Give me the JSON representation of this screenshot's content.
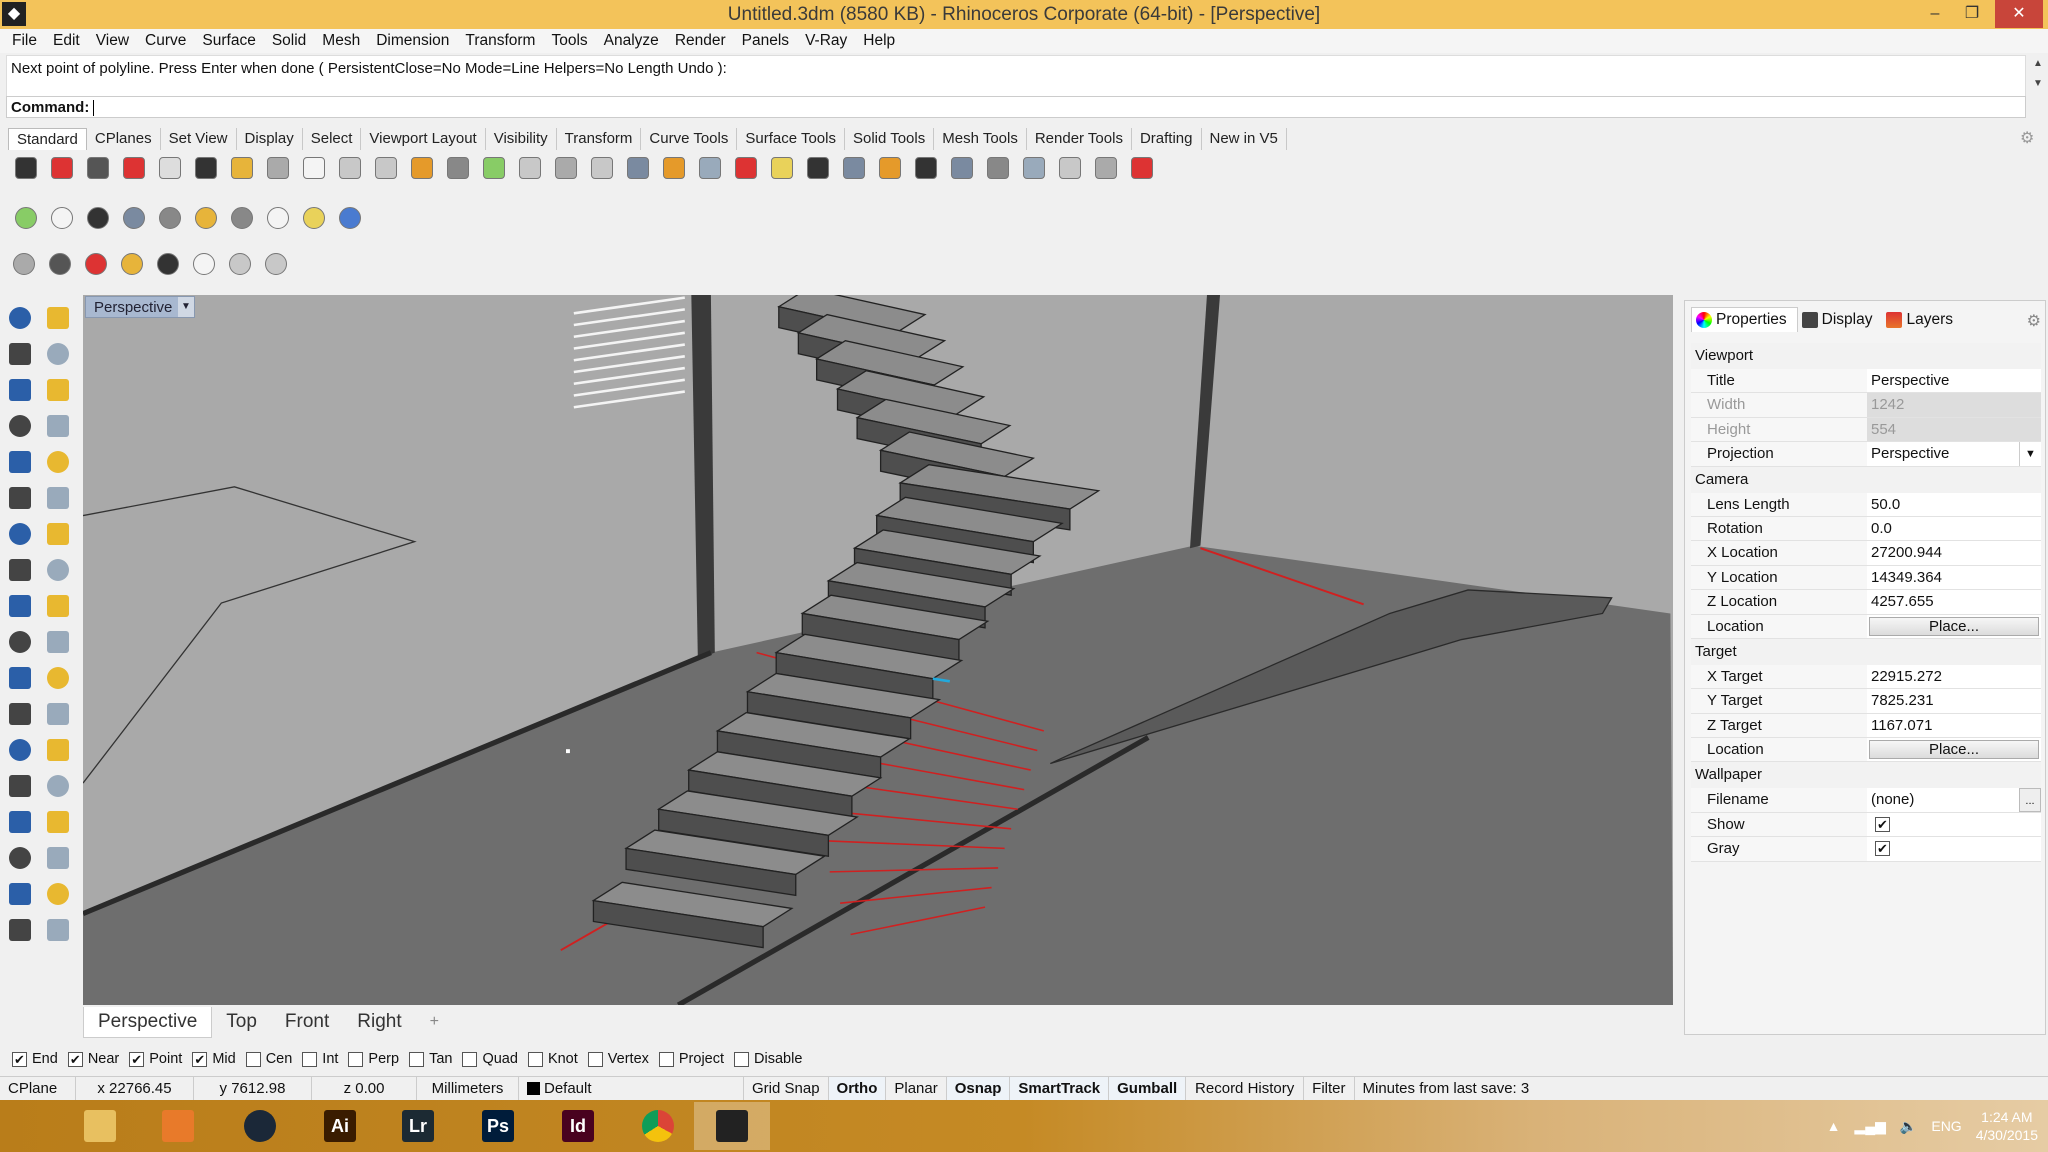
{
  "window": {
    "title": "Untitled.3dm (8580 KB) - Rhinoceros Corporate (64-bit) - [Perspective]",
    "minimize": "–",
    "restore": "❐",
    "close": "✕"
  },
  "menu": [
    "File",
    "Edit",
    "View",
    "Curve",
    "Surface",
    "Solid",
    "Mesh",
    "Dimension",
    "Transform",
    "Tools",
    "Analyze",
    "Render",
    "Panels",
    "V-Ray",
    "Help"
  ],
  "command": {
    "history": "Next point of polyline. Press Enter when done ( PersistentClose=No  Mode=Line  Helpers=No  Length  Undo ):",
    "prompt": "Command:",
    "value": ""
  },
  "toolbar_tabs": [
    "Standard",
    "CPlanes",
    "Set View",
    "Display",
    "Select",
    "Viewport Layout",
    "Visibility",
    "Transform",
    "Curve Tools",
    "Surface Tools",
    "Solid Tools",
    "Mesh Tools",
    "Render Tools",
    "Drafting",
    "New in V5"
  ],
  "toolbar_row1": [
    "new-file",
    "open",
    "save",
    "print",
    "import",
    "cut",
    "copy",
    "paste",
    "undo",
    "pan",
    "rotate-view",
    "zoom-dynamic",
    "zoom-window",
    "zoom-extents",
    "zoom-selected",
    "undo-view",
    "four-viewports",
    "car",
    "set-view",
    "osnap-circle",
    "points",
    "light-bulb",
    "lock",
    "layers",
    "color-wheel",
    "sphere-shaded",
    "sphere-rendered",
    "sphere-blue",
    "vray-lamp",
    "vray-settings",
    "dimension",
    "help"
  ],
  "toolbar_row2": [
    "vray-material",
    "vray-tag",
    "vray-tags",
    "vray-render",
    "vray-rt",
    "vray-lights",
    "vray-sun",
    "vray-sphere",
    "vray-forest",
    "vray-help"
  ],
  "toolbar_row3": [
    "sun-light",
    "plane-light",
    "sphere-light",
    "dome-light",
    "mesh-light",
    "spot-light",
    "ies-light",
    "directional-light"
  ],
  "left_tools": [
    "select",
    "point",
    "polyline",
    "curve",
    "circle",
    "arc",
    "polygon",
    "rectangle",
    "ellipse",
    "fillet",
    "surface",
    "revolve",
    "solid-box",
    "boolean",
    "extrude",
    "mesh",
    "transform-a",
    "transform-b",
    "move",
    "scale",
    "boolean-union",
    "boolean-split",
    "offset",
    "blend",
    "text",
    "dimension",
    "array",
    "group",
    "analyze-a",
    "analyze-b",
    "grid",
    "align",
    "render-a",
    "check",
    "render-b",
    "light"
  ],
  "colors": {
    "viewport_bg": "#a9a9a9",
    "floor": "#6e6e6e",
    "red_line": "#d02020",
    "accent": "#f3c35a"
  },
  "viewport": {
    "label": "Perspective"
  },
  "view_tabs": [
    "Perspective",
    "Top",
    "Front",
    "Right",
    "+"
  ],
  "osnap": [
    {
      "label": "End",
      "checked": true
    },
    {
      "label": "Near",
      "checked": true
    },
    {
      "label": "Point",
      "checked": true
    },
    {
      "label": "Mid",
      "checked": true
    },
    {
      "label": "Cen",
      "checked": false
    },
    {
      "label": "Int",
      "checked": false
    },
    {
      "label": "Perp",
      "checked": false
    },
    {
      "label": "Tan",
      "checked": false
    },
    {
      "label": "Quad",
      "checked": false
    },
    {
      "label": "Knot",
      "checked": false
    },
    {
      "label": "Vertex",
      "checked": false
    },
    {
      "label": "Project",
      "checked": false
    },
    {
      "label": "Disable",
      "checked": false
    }
  ],
  "status": {
    "cplane": "CPlane",
    "x": "x 22766.45",
    "y": "y 7612.98",
    "z": "z 0.00",
    "units": "Millimeters",
    "layer": "Default",
    "grid_snap": "Grid Snap",
    "ortho": "Ortho",
    "planar": "Planar",
    "osnap": "Osnap",
    "smarttrack": "SmartTrack",
    "gumball": "Gumball",
    "record_history": "Record History",
    "filter": "Filter",
    "save_info": "Minutes from last save: 3"
  },
  "panel": {
    "tabs": [
      "Properties",
      "Display",
      "Layers"
    ],
    "sections": [
      {
        "title": "Viewport",
        "rows": [
          {
            "k": "Title",
            "v": "Perspective"
          },
          {
            "k": "Width",
            "v": "1242",
            "disabled": true
          },
          {
            "k": "Height",
            "v": "554",
            "disabled": true
          },
          {
            "k": "Projection",
            "v": "Perspective",
            "dropdown": true
          }
        ]
      },
      {
        "title": "Camera",
        "rows": [
          {
            "k": "Lens Length",
            "v": "50.0"
          },
          {
            "k": "Rotation",
            "v": "0.0"
          },
          {
            "k": "X Location",
            "v": "27200.944"
          },
          {
            "k": "Y Location",
            "v": "14349.364"
          },
          {
            "k": "Z Location",
            "v": "4257.655"
          },
          {
            "k": "Location",
            "v": "Place...",
            "button": true
          }
        ]
      },
      {
        "title": "Target",
        "rows": [
          {
            "k": "X Target",
            "v": "22915.272"
          },
          {
            "k": "Y Target",
            "v": "7825.231"
          },
          {
            "k": "Z Target",
            "v": "1167.071"
          },
          {
            "k": "Location",
            "v": "Place...",
            "button": true
          }
        ]
      },
      {
        "title": "Wallpaper",
        "rows": [
          {
            "k": "Filename",
            "v": "(none)",
            "browse": "..."
          },
          {
            "k": "Show",
            "checked": true
          },
          {
            "k": "Gray",
            "checked": true
          }
        ]
      }
    ]
  },
  "taskbar": {
    "apps": [
      {
        "name": "start",
        "label": ""
      },
      {
        "name": "file-explorer",
        "label": ""
      },
      {
        "name": "media-player",
        "label": ""
      },
      {
        "name": "steam",
        "label": ""
      },
      {
        "name": "illustrator",
        "label": "Ai"
      },
      {
        "name": "lightroom",
        "label": "Lr"
      },
      {
        "name": "photoshop",
        "label": "Ps"
      },
      {
        "name": "indesign",
        "label": "Id"
      },
      {
        "name": "chrome",
        "label": ""
      },
      {
        "name": "rhino",
        "label": ""
      }
    ],
    "lang": "ENG",
    "time": "1:24 AM",
    "date": "4/30/2015"
  }
}
